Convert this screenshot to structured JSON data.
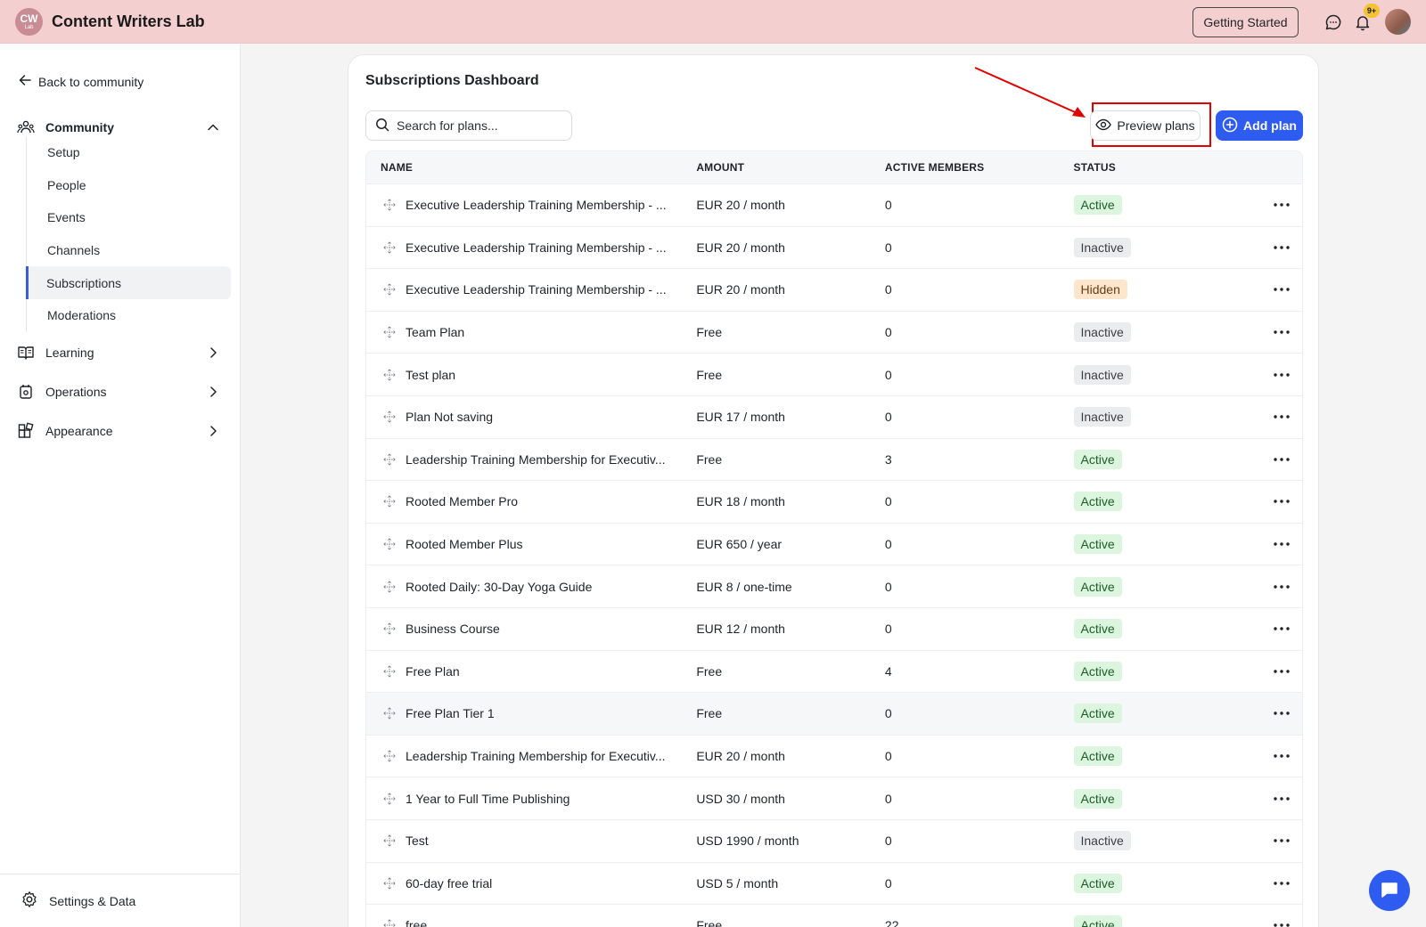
{
  "app": {
    "logo_main": "CW",
    "logo_sub": "Lab",
    "title": "Content Writers Lab",
    "getting_started": "Getting Started",
    "notification_badge": "9+"
  },
  "sidebar": {
    "back_label": "Back to community",
    "community_label": "Community",
    "sub_items": [
      "Setup",
      "People",
      "Events",
      "Channels",
      "Subscriptions",
      "Moderations"
    ],
    "active_item": "Subscriptions",
    "learning_label": "Learning",
    "operations_label": "Operations",
    "appearance_label": "Appearance",
    "settings_label": "Settings & Data"
  },
  "main": {
    "title": "Subscriptions Dashboard",
    "search_placeholder": "Search for plans...",
    "preview_label": "Preview plans",
    "add_label": "Add plan",
    "columns": {
      "name": "NAME",
      "amount": "AMOUNT",
      "members": "ACTIVE MEMBERS",
      "status": "STATUS"
    },
    "rows": [
      {
        "name": "Executive Leadership Training Membership - ...",
        "amount": "EUR 20 / month",
        "members": "0",
        "status": "Active"
      },
      {
        "name": "Executive Leadership Training Membership - ...",
        "amount": "EUR 20 / month",
        "members": "0",
        "status": "Inactive"
      },
      {
        "name": "Executive Leadership Training Membership - ...",
        "amount": "EUR 20 / month",
        "members": "0",
        "status": "Hidden"
      },
      {
        "name": "Team Plan",
        "amount": "Free",
        "members": "0",
        "status": "Inactive"
      },
      {
        "name": "Test plan",
        "amount": "Free",
        "members": "0",
        "status": "Inactive"
      },
      {
        "name": "Plan Not saving",
        "amount": "EUR 17 / month",
        "members": "0",
        "status": "Inactive"
      },
      {
        "name": "Leadership Training Membership for Executiv...",
        "amount": "Free",
        "members": "3",
        "status": "Active"
      },
      {
        "name": "Rooted Member Pro",
        "amount": "EUR 18 / month",
        "members": "0",
        "status": "Active"
      },
      {
        "name": "Rooted Member Plus",
        "amount": "EUR 650 / year",
        "members": "0",
        "status": "Active"
      },
      {
        "name": "Rooted Daily: 30-Day Yoga Guide",
        "amount": "EUR 8 / one-time",
        "members": "0",
        "status": "Active"
      },
      {
        "name": "Business Course",
        "amount": "EUR 12 / month",
        "members": "0",
        "status": "Active"
      },
      {
        "name": "Free Plan",
        "amount": "Free",
        "members": "4",
        "status": "Active"
      },
      {
        "name": "Free Plan Tier 1",
        "amount": "Free",
        "members": "0",
        "status": "Active"
      },
      {
        "name": "Leadership Training Membership for Executiv...",
        "amount": "EUR 20 / month",
        "members": "0",
        "status": "Active"
      },
      {
        "name": "1 Year to Full Time Publishing",
        "amount": "USD 30 / month",
        "members": "0",
        "status": "Active"
      },
      {
        "name": "Test",
        "amount": "USD 1990 / month",
        "members": "0",
        "status": "Inactive"
      },
      {
        "name": "60-day free trial",
        "amount": "USD 5 / month",
        "members": "0",
        "status": "Active"
      },
      {
        "name": "free",
        "amount": "Free",
        "members": "22",
        "status": "Active"
      }
    ],
    "hovered_row": "Free Plan Tier 1"
  },
  "colors": {
    "topbar": "#f4cfd0",
    "accent": "#2f5cf0",
    "highlight": "#e00000"
  }
}
